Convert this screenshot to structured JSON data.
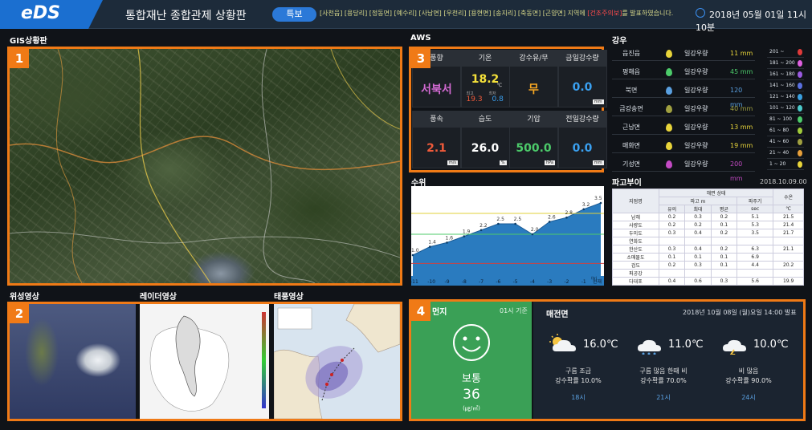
{
  "header": {
    "logo": "eDS",
    "title": "통합재난 종합관제 상황판",
    "alert_button": "특보",
    "alert_regions": "[사천읍] [용당리] [정동면] [예수리] [사남면] [우천리] [용현면] [송지리] [축동면] [곤양면] 지역에",
    "alert_type": "[건조주의보]",
    "alert_suffix": "를 발표하였습니다.",
    "datetime": "2018년 05월 01일 11시10분"
  },
  "sections": {
    "gis": "GIS상황판",
    "satellite": "위성영상",
    "radar": "레이더영상",
    "typhoon": "태풍영상",
    "aws": "AWS",
    "rainfall": "강우",
    "buoy": "파고부이",
    "water": "수위",
    "dust": "먼지"
  },
  "badges": [
    "1",
    "2",
    "3",
    "4"
  ],
  "aws": {
    "cells": [
      {
        "label": "풍향",
        "value": "서북서",
        "color": "#d36ad3"
      },
      {
        "label": "기온",
        "value": "18.2",
        "unit_small": "℃",
        "min_label": "최고",
        "min": "19.3",
        "max_label": "최저",
        "max": "0.8",
        "color": "#f5e13a"
      },
      {
        "label": "강수유/무",
        "value": "무",
        "color": "#f5a623"
      },
      {
        "label": "금일강수량",
        "value": "0.0",
        "unit": "mm",
        "color": "#3aa0f0"
      },
      {
        "label": "풍속",
        "value": "2.1",
        "unit": "m/s",
        "color": "#f05a3a"
      },
      {
        "label": "습도",
        "value": "26.0",
        "unit": "%",
        "color": "#ffffff"
      },
      {
        "label": "기압",
        "value": "500.0",
        "unit": "hPa",
        "color": "#4ccb6a"
      },
      {
        "label": "전일강수량",
        "value": "0.0",
        "unit": "mm",
        "color": "#3aa0f0"
      }
    ]
  },
  "rainfall": {
    "rows": [
      {
        "name": "읍진읍",
        "label": "일강우량",
        "value": "11 mm",
        "drop": "#e8d43a",
        "vcolor": "#e8d43a"
      },
      {
        "name": "평해읍",
        "label": "일강우량",
        "value": "45 mm",
        "drop": "#4ccb6a",
        "vcolor": "#4ccb6a"
      },
      {
        "name": "북면",
        "label": "일강우량",
        "value": "120 mm",
        "drop": "#5aa0e0",
        "vcolor": "#5aa0e0"
      },
      {
        "name": "금강송면",
        "label": "일강우량",
        "value": "40 mm",
        "drop": "#a0a040",
        "vcolor": "#a0a040"
      },
      {
        "name": "근남면",
        "label": "일강우량",
        "value": "13 mm",
        "drop": "#e8d43a",
        "vcolor": "#e8d43a"
      },
      {
        "name": "매화면",
        "label": "일강우량",
        "value": "19 mm",
        "drop": "#e8d43a",
        "vcolor": "#e8d43a"
      },
      {
        "name": "기성면",
        "label": "일강우량",
        "value": "200 mm",
        "drop": "#c44ac4",
        "vcolor": "#c44ac4"
      }
    ],
    "legend": [
      {
        "range": "201 ~",
        "color": "#e03a3a"
      },
      {
        "range": "181 ~ 200",
        "color": "#e060e0"
      },
      {
        "range": "161 ~ 180",
        "color": "#9a5ae0"
      },
      {
        "range": "141 ~ 160",
        "color": "#5a70e0"
      },
      {
        "range": "121 ~ 140",
        "color": "#3aa0e0"
      },
      {
        "range": "101 ~ 120",
        "color": "#4ccbcb"
      },
      {
        "range": "81 ~ 100",
        "color": "#4ccb6a"
      },
      {
        "range": "61 ~ 80",
        "color": "#a0cb3a"
      },
      {
        "range": "41 ~ 60",
        "color": "#a0a040"
      },
      {
        "range": "21 ~ 40",
        "color": "#e8a03a"
      },
      {
        "range": "1 ~ 20",
        "color": "#e8d43a"
      }
    ]
  },
  "buoy": {
    "date": "2018.10.09.00",
    "header": {
      "station": "지점명",
      "sea_state": "해면 상태",
      "wave_height": "파고 m",
      "period": "파주기",
      "period_unit": "sec",
      "water_temp": "수온",
      "temp_unit": "℃",
      "cols": [
        "유의",
        "최대",
        "평균"
      ]
    },
    "rows": [
      [
        "남해",
        "0.2",
        "0.3",
        "0.2",
        "5.1",
        "21.5"
      ],
      [
        "사량도",
        "0.2",
        "0.2",
        "0.1",
        "5.3",
        "21.4"
      ],
      [
        "두미도",
        "0.3",
        "0.4",
        "0.2",
        "3.5",
        "21.7"
      ],
      [
        "연화도",
        "",
        "",
        "",
        "",
        ""
      ],
      [
        "한산도",
        "0.3",
        "0.4",
        "0.2",
        "6.3",
        "21.1"
      ],
      [
        "소매물도",
        "0.1",
        "0.1",
        "0.1",
        "6.9",
        ""
      ],
      [
        "검도",
        "0.2",
        "0.3",
        "0.1",
        "4.4",
        "20.2"
      ],
      [
        "퍼공강",
        "",
        "",
        "",
        "",
        ""
      ],
      [
        "다대포",
        "0.4",
        "0.6",
        "0.3",
        "5.6",
        "19.9"
      ]
    ]
  },
  "chart_data": {
    "type": "area",
    "title": "수위",
    "x": [
      "-11",
      "-10",
      "-9",
      "-8",
      "-7",
      "-6",
      "-5",
      "-4",
      "-3",
      "-2",
      "-1",
      "현재"
    ],
    "xlabel": "",
    "ylabel": "",
    "values": [
      1.0,
      1.4,
      1.6,
      1.9,
      2.2,
      2.5,
      2.5,
      2.0,
      2.6,
      2.8,
      3.2,
      3.5
    ],
    "ylim": [
      0,
      4
    ],
    "x_suffix": "(hr)",
    "thresholds": [
      {
        "value": 3.0,
        "color": "#e0d23a"
      },
      {
        "value": 2.0,
        "color": "#4ccb6a"
      }
    ]
  },
  "dust": {
    "title": "먼지",
    "time": "01시 기준",
    "status": "보통",
    "value": "36",
    "unit": "(㎍/㎥)"
  },
  "forecast": {
    "region": "매전면",
    "issued": "2018년 10월 08일 (월)요일 14:00 발표",
    "items": [
      {
        "temp": "16.0℃",
        "desc": "구름 조금",
        "rain": "강수확률 10.0%",
        "hour": "18시",
        "icon": "partly-cloudy-icon"
      },
      {
        "temp": "11.0℃",
        "desc": "구름 많음 한때 비",
        "rain": "강수확률 70.0%",
        "hour": "21시",
        "icon": "rain-cloud-icon"
      },
      {
        "temp": "10.0℃",
        "desc": "비 많음",
        "rain": "강수확률 90.0%",
        "hour": "24시",
        "icon": "thunder-cloud-icon"
      }
    ]
  }
}
